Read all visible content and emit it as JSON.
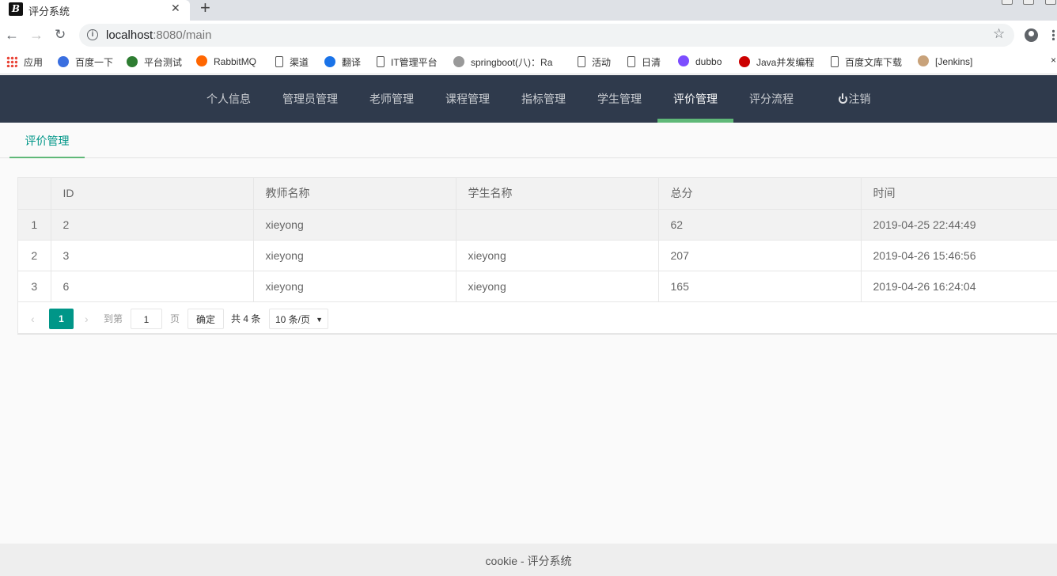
{
  "browser": {
    "tab_title": "评分系统",
    "favicon_text": "B",
    "url_host": "localhost",
    "url_rest": ":8080/main",
    "bookmarks": [
      {
        "label": "应用",
        "icon": "apps-grid-icon",
        "color": "#e94235"
      },
      {
        "label": "百度一下",
        "icon": "baidu-paw-icon",
        "color": "#3a6fe0"
      },
      {
        "label": "平台测试",
        "icon": "globe-icon",
        "color": "#2e7d32"
      },
      {
        "label": "RabbitMQ",
        "icon": "rabbitmq-icon",
        "color": "#f60"
      },
      {
        "label": "渠道",
        "icon": "page-icon",
        "color": "#fff"
      },
      {
        "label": "翻译",
        "icon": "translate-icon",
        "color": "#1a73e8"
      },
      {
        "label": "IT管理平台",
        "icon": "page-icon",
        "color": "#fff"
      },
      {
        "label": "springboot(八)：Ra",
        "icon": "spring-icon",
        "color": "#999"
      },
      {
        "label": "活动",
        "icon": "page-icon",
        "color": "#fff"
      },
      {
        "label": "日清",
        "icon": "page-icon",
        "color": "#fff"
      },
      {
        "label": "dubbo",
        "icon": "dubbo-icon",
        "color": "#7c4dff"
      },
      {
        "label": "Java并发编程",
        "icon": "csdn-icon",
        "color": "#c00"
      },
      {
        "label": "百度文库下载",
        "icon": "page-icon",
        "color": "#fff"
      },
      {
        "label": "[Jenkins]",
        "icon": "jenkins-icon",
        "color": "#c8a27a"
      }
    ],
    "bookmarks_close": "×"
  },
  "nav": {
    "items": [
      "个人信息",
      "管理员管理",
      "老师管理",
      "课程管理",
      "指标管理",
      "学生管理",
      "评价管理",
      "评分流程"
    ],
    "active_index": 6,
    "logout": "注销",
    "bg_color": "#2f3a4c",
    "active_color": "#5fb878"
  },
  "page": {
    "subtab": "评价管理"
  },
  "table": {
    "columns": [
      "",
      "ID",
      "教师名称",
      "学生名称",
      "总分",
      "时间"
    ],
    "rows": [
      {
        "num": "1",
        "id": "2",
        "teacher": "xieyong",
        "student": "",
        "score": "62",
        "time": "2019-04-25 22:44:49"
      },
      {
        "num": "2",
        "id": "3",
        "teacher": "xieyong",
        "student": "xieyong",
        "score": "207",
        "time": "2019-04-26 15:46:56"
      },
      {
        "num": "3",
        "id": "6",
        "teacher": "xieyong",
        "student": "xieyong",
        "score": "165",
        "time": "2019-04-26 16:24:04"
      }
    ]
  },
  "pager": {
    "current": "1",
    "goto_label": "到第",
    "page_input": "1",
    "page_unit": "页",
    "confirm": "确定",
    "total": "共 4 条",
    "page_size": "10 条/页"
  },
  "footer": {
    "text": "cookie - 评分系统"
  }
}
